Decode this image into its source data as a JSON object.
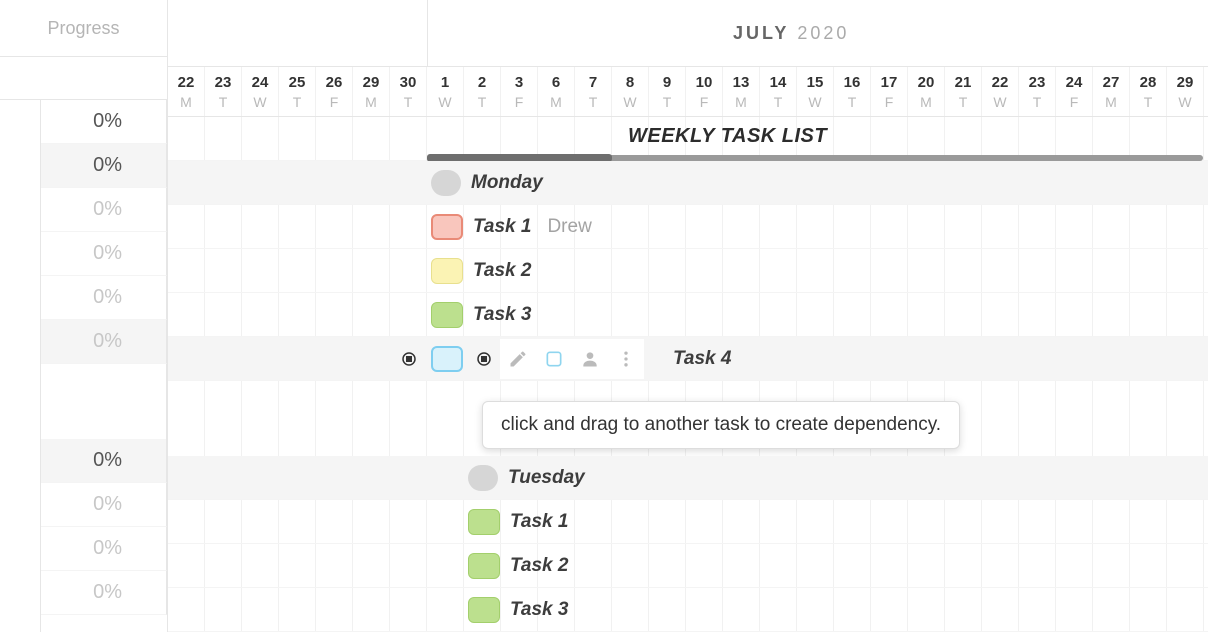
{
  "sidebar": {
    "header": "Progress",
    "rows": [
      {
        "id": "group-mon",
        "value": "0%",
        "hl": false,
        "dim": false
      },
      {
        "id": "monday-label",
        "value": "0%",
        "hl": true,
        "dim": false
      },
      {
        "id": "task1-mon",
        "value": "0%",
        "hl": false,
        "dim": true
      },
      {
        "id": "task2-mon",
        "value": "0%",
        "hl": false,
        "dim": true
      },
      {
        "id": "task3-mon",
        "value": "0%",
        "hl": false,
        "dim": true
      },
      {
        "id": "task4-mon",
        "value": "0%",
        "hl": true,
        "dim": true
      },
      {
        "id": "spacer",
        "value": "",
        "hl": false,
        "dim": true
      },
      {
        "id": "group-tue",
        "value": "0%",
        "hl": true,
        "dim": false
      },
      {
        "id": "task1-tue",
        "value": "0%",
        "hl": false,
        "dim": true
      },
      {
        "id": "task2-tue",
        "value": "0%",
        "hl": false,
        "dim": true
      },
      {
        "id": "task3-tue",
        "value": "0%",
        "hl": false,
        "dim": true
      }
    ]
  },
  "header": {
    "month": "JULY",
    "year": "2020",
    "dates": [
      {
        "num": "22",
        "dow": "M"
      },
      {
        "num": "23",
        "dow": "T"
      },
      {
        "num": "24",
        "dow": "W"
      },
      {
        "num": "25",
        "dow": "T"
      },
      {
        "num": "26",
        "dow": "F"
      },
      {
        "num": "29",
        "dow": "M"
      },
      {
        "num": "30",
        "dow": "T"
      },
      {
        "num": "1",
        "dow": "W"
      },
      {
        "num": "2",
        "dow": "T"
      },
      {
        "num": "3",
        "dow": "F"
      },
      {
        "num": "6",
        "dow": "M"
      },
      {
        "num": "7",
        "dow": "T"
      },
      {
        "num": "8",
        "dow": "W"
      },
      {
        "num": "9",
        "dow": "T"
      },
      {
        "num": "10",
        "dow": "F"
      },
      {
        "num": "13",
        "dow": "M"
      },
      {
        "num": "14",
        "dow": "T"
      },
      {
        "num": "15",
        "dow": "W"
      },
      {
        "num": "16",
        "dow": "T"
      },
      {
        "num": "17",
        "dow": "F"
      },
      {
        "num": "20",
        "dow": "M"
      },
      {
        "num": "21",
        "dow": "T"
      },
      {
        "num": "22",
        "dow": "W"
      },
      {
        "num": "23",
        "dow": "T"
      },
      {
        "num": "24",
        "dow": "F"
      },
      {
        "num": "27",
        "dow": "M"
      },
      {
        "num": "28",
        "dow": "T"
      },
      {
        "num": "29",
        "dow": "W"
      }
    ]
  },
  "tasks": {
    "group_title": "WEEKLY TASK LIST",
    "monday": {
      "label": "Monday",
      "items": [
        {
          "label": "Task 1",
          "assignee": "Drew",
          "color": "red"
        },
        {
          "label": "Task 2",
          "assignee": "",
          "color": "yellow"
        },
        {
          "label": "Task 3",
          "assignee": "",
          "color": "green"
        },
        {
          "label": "Task 4",
          "assignee": "",
          "color": "blue"
        }
      ]
    },
    "tuesday": {
      "label": "Tuesday",
      "items": [
        {
          "label": "Task 1",
          "assignee": "",
          "color": "green"
        },
        {
          "label": "Task 2",
          "assignee": "",
          "color": "green"
        },
        {
          "label": "Task 3",
          "assignee": "",
          "color": "green"
        }
      ]
    }
  },
  "tooltip": {
    "text": "click and drag to another task to create dependency."
  },
  "icons": {
    "pencil": "pencil-icon",
    "checkbox": "checkbox-icon",
    "person": "person-icon",
    "more": "more-vertical-icon",
    "drag": "dependency-handle-icon"
  }
}
